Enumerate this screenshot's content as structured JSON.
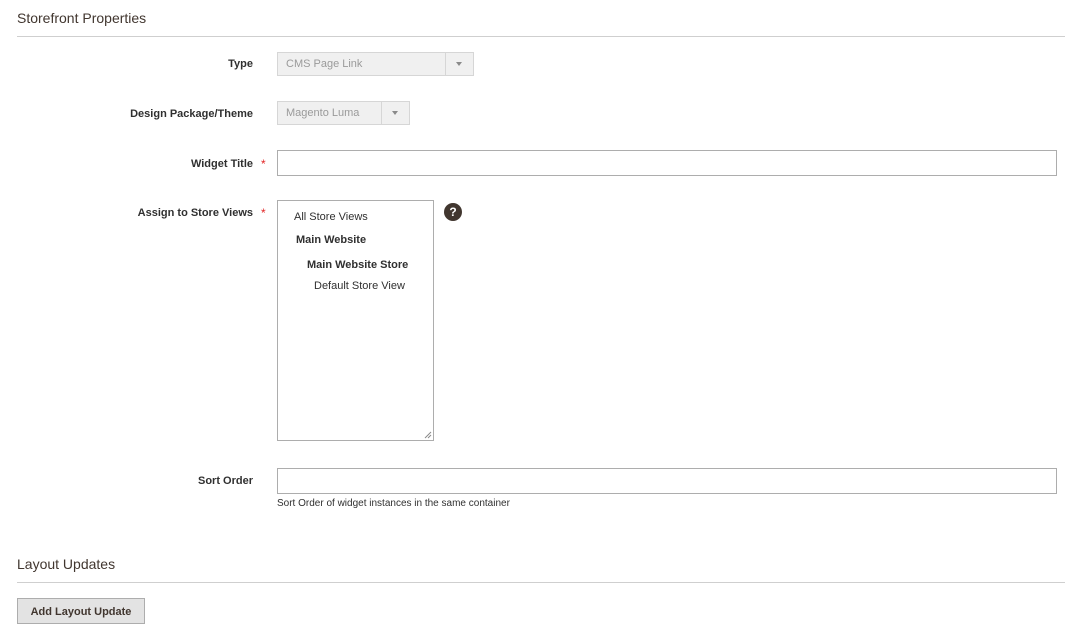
{
  "storefront": {
    "title": "Storefront Properties",
    "type": {
      "label": "Type",
      "value": "CMS Page Link"
    },
    "theme": {
      "label": "Design Package/Theme",
      "value": "Magento Luma"
    },
    "widget_title": {
      "label": "Widget Title",
      "required_mark": "*",
      "value": ""
    },
    "store_views": {
      "label": "Assign to Store Views",
      "required_mark": "*",
      "help_icon": "?",
      "options": [
        "All Store Views",
        "Main Website",
        "Main Website Store",
        "Default Store View"
      ]
    },
    "sort_order": {
      "label": "Sort Order",
      "value": "",
      "note": "Sort Order of widget instances in the same container"
    }
  },
  "layout_updates": {
    "title": "Layout Updates",
    "add_button_label": "Add Layout Update"
  },
  "colors": {
    "required": "#e22626",
    "heading": "#41362f"
  }
}
